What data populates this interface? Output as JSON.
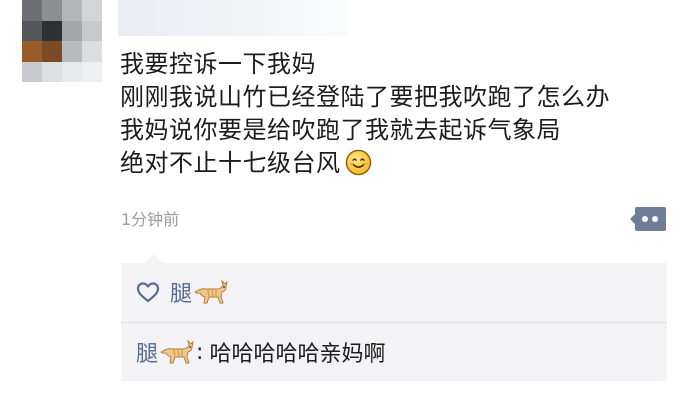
{
  "post": {
    "lines": [
      "我要控诉一下我妈",
      "刚刚我说山竹已经登陆了要把我吹跑了怎么办",
      "我妈说你要是给吹跑了我就去起诉气象局",
      "绝对不止十七级台风"
    ],
    "emoji": "smile-emoji"
  },
  "timestamp": "1分钟前",
  "more_button": {
    "icon": "more-dots-icon"
  },
  "likes": {
    "icon": "heart-icon",
    "user_name": "腿",
    "user_emoji": "cat-emoji"
  },
  "comments": [
    {
      "author": "腿",
      "author_emoji": "cat-emoji",
      "colon": ":",
      "text": "哈哈哈哈哈亲妈啊"
    }
  ],
  "colors": {
    "link_blue": "#576b95",
    "timestamp_gray": "#9b9b9b",
    "feedback_bg": "#f3f3f5",
    "text_dark": "#1c1c1c"
  }
}
